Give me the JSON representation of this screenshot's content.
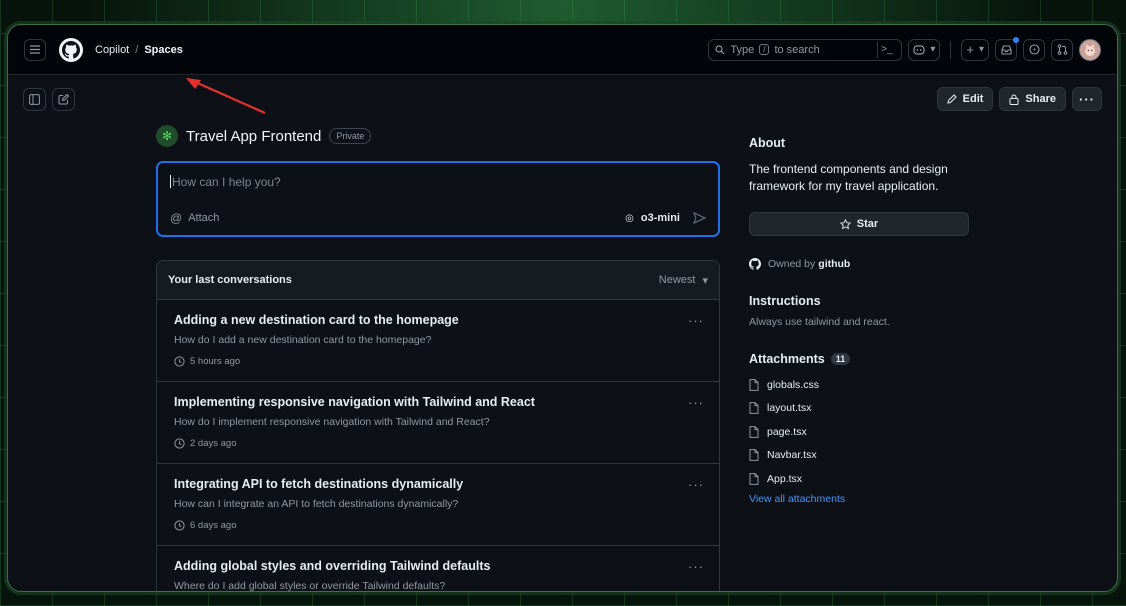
{
  "header": {
    "breadcrumb": [
      "Copilot",
      "Spaces"
    ],
    "separator": "/",
    "search_prefix": "Type",
    "search_key": "/",
    "search_suffix": "to search",
    "cmd_glyph": ">_"
  },
  "toolbar": {
    "edit_label": "Edit",
    "share_label": "Share"
  },
  "space": {
    "title": "Travel App Frontend",
    "visibility": "Private"
  },
  "chat": {
    "placeholder": "How can I help you?",
    "attach_label": "Attach",
    "model": "o3-mini"
  },
  "conversations": {
    "heading": "Your last conversations",
    "sort_label": "Newest",
    "items": [
      {
        "title": "Adding a new destination card to the homepage",
        "subtitle": "How do I add a new destination card to the homepage?",
        "time": "5 hours ago"
      },
      {
        "title": "Implementing responsive navigation with Tailwind and React",
        "subtitle": "How do I implement responsive navigation with Tailwind and React?",
        "time": "2 days ago"
      },
      {
        "title": "Integrating API to fetch destinations dynamically",
        "subtitle": "How can I integrate an API to fetch destinations dynamically?",
        "time": "6 days ago"
      },
      {
        "title": "Adding global styles and overriding Tailwind defaults",
        "subtitle": "Where do I add global styles or override Tailwind defaults?",
        "time": ""
      }
    ]
  },
  "sidebar": {
    "about_heading": "About",
    "about_text": "The frontend components and design framework for my travel application.",
    "star_label": "Star",
    "owned_prefix": "Owned by",
    "owner": "github",
    "instructions_heading": "Instructions",
    "instructions_text": "Always use tailwind and react.",
    "attachments_heading": "Attachments",
    "attachments_count": "11",
    "files": [
      "globals.css",
      "layout.tsx",
      "page.tsx",
      "Navbar.tsx",
      "App.tsx"
    ],
    "view_all": "View all attachments"
  },
  "colors": {
    "accent_blue": "#1f6feb",
    "link": "#4493f8",
    "annotation_arrow": "#e5302b"
  },
  "icons": [
    "hamburger-icon",
    "github-logo-icon",
    "search-icon",
    "terminal-icon",
    "copilot-icon",
    "plus-icon",
    "inbox-icon",
    "issue-icon",
    "pull-request-icon",
    "sidebar-toggle-icon",
    "new-chat-icon",
    "pencil-icon",
    "lock-icon",
    "kebab-icon",
    "at-icon",
    "send-icon",
    "clock-icon",
    "star-icon",
    "file-icon"
  ]
}
